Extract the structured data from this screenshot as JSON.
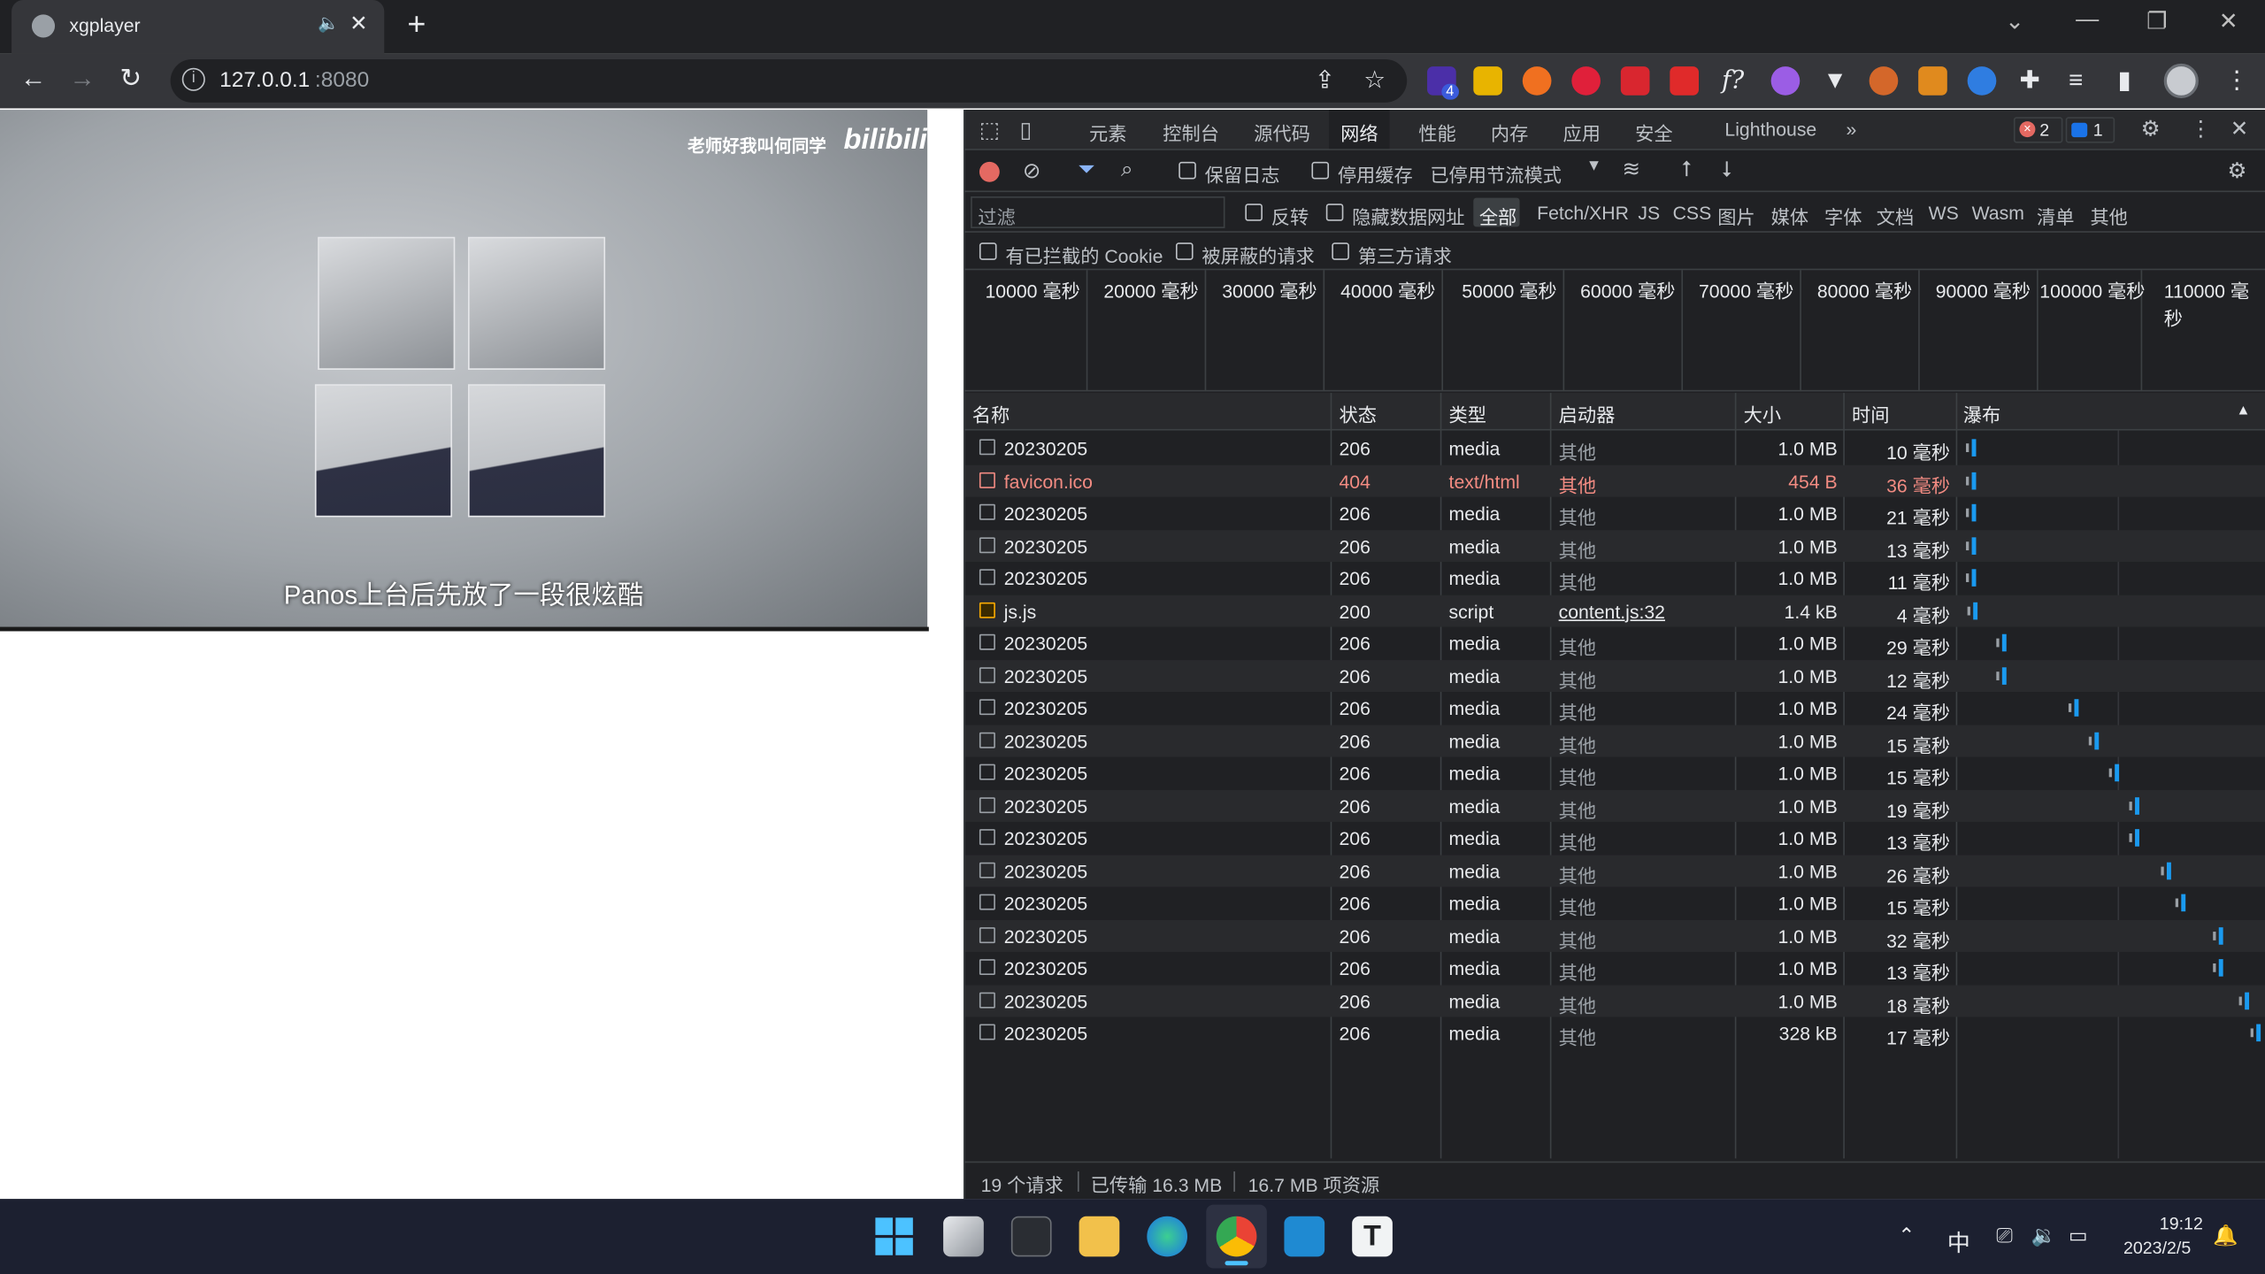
{
  "browser": {
    "tab_title": "xgplayer",
    "tab_close": "✕",
    "new_tab": "+",
    "url_host": "127.0.0.1",
    "url_port": ":8080",
    "ext_badge": "4"
  },
  "video": {
    "watermark": "老师好我叫何同学",
    "logo": "bilibili",
    "subtitle": "Panos上台后先放了一段很炫酷"
  },
  "devtools": {
    "tabs": [
      "元素",
      "控制台",
      "源代码",
      "网络",
      "性能",
      "内存",
      "应用",
      "安全",
      "Lighthouse"
    ],
    "active_tab": "网络",
    "more": "»",
    "errors": "2",
    "messages": "1",
    "controls": {
      "preserve_log": "保留日志",
      "disable_cache": "停用缓存",
      "throttle": "已停用节流模式"
    },
    "filter": {
      "placeholder": "过滤",
      "invert": "反转",
      "hide_data_urls": "隐藏数据网址",
      "types": [
        "全部",
        "Fetch/XHR",
        "JS",
        "CSS",
        "图片",
        "媒体",
        "字体",
        "文档",
        "WS",
        "Wasm",
        "清单",
        "其他"
      ],
      "blocked_cookies": "有已拦截的 Cookie",
      "blocked_requests": "被屏蔽的请求",
      "third_party": "第三方请求"
    },
    "timeline_ticks": [
      "10000 毫秒",
      "20000 毫秒",
      "30000 毫秒",
      "40000 毫秒",
      "50000 毫秒",
      "60000 毫秒",
      "70000 毫秒",
      "80000 毫秒",
      "90000 毫秒",
      "100000 毫秒",
      "110000 毫秒"
    ],
    "columns": {
      "name": "名称",
      "status": "状态",
      "type": "类型",
      "initiator": "启动器",
      "size": "大小",
      "time": "时间",
      "waterfall": "瀑布"
    },
    "rows": [
      {
        "name": "20230205",
        "status": "206",
        "type": "media",
        "initiator": "其他",
        "size": "1.0 MB",
        "time": "10 毫秒",
        "wf": 0.004
      },
      {
        "name": "favicon.ico",
        "status": "404",
        "type": "text/html",
        "initiator": "其他",
        "size": "454 B",
        "time": "36 毫秒",
        "wf": 0.004,
        "error": true
      },
      {
        "name": "20230205",
        "status": "206",
        "type": "media",
        "initiator": "其他",
        "size": "1.0 MB",
        "time": "21 毫秒",
        "wf": 0.004
      },
      {
        "name": "20230205",
        "status": "206",
        "type": "media",
        "initiator": "其他",
        "size": "1.0 MB",
        "time": "13 毫秒",
        "wf": 0.004
      },
      {
        "name": "20230205",
        "status": "206",
        "type": "media",
        "initiator": "其他",
        "size": "1.0 MB",
        "time": "11 毫秒",
        "wf": 0.004
      },
      {
        "name": "js.js",
        "status": "200",
        "type": "script",
        "initiator": "content.js:32",
        "size": "1.4 kB",
        "time": "4 毫秒",
        "wf": 0.01,
        "script": true
      },
      {
        "name": "20230205",
        "status": "206",
        "type": "media",
        "initiator": "其他",
        "size": "1.0 MB",
        "time": "29 毫秒",
        "wf": 0.11
      },
      {
        "name": "20230205",
        "status": "206",
        "type": "media",
        "initiator": "其他",
        "size": "1.0 MB",
        "time": "12 毫秒",
        "wf": 0.11
      },
      {
        "name": "20230205",
        "status": "206",
        "type": "media",
        "initiator": "其他",
        "size": "1.0 MB",
        "time": "24 毫秒",
        "wf": 0.36
      },
      {
        "name": "20230205",
        "status": "206",
        "type": "media",
        "initiator": "其他",
        "size": "1.0 MB",
        "time": "15 毫秒",
        "wf": 0.43
      },
      {
        "name": "20230205",
        "status": "206",
        "type": "media",
        "initiator": "其他",
        "size": "1.0 MB",
        "time": "15 毫秒",
        "wf": 0.5
      },
      {
        "name": "20230205",
        "status": "206",
        "type": "media",
        "initiator": "其他",
        "size": "1.0 MB",
        "time": "19 毫秒",
        "wf": 0.57
      },
      {
        "name": "20230205",
        "status": "206",
        "type": "media",
        "initiator": "其他",
        "size": "1.0 MB",
        "time": "13 毫秒",
        "wf": 0.57
      },
      {
        "name": "20230205",
        "status": "206",
        "type": "media",
        "initiator": "其他",
        "size": "1.0 MB",
        "time": "26 毫秒",
        "wf": 0.68
      },
      {
        "name": "20230205",
        "status": "206",
        "type": "media",
        "initiator": "其他",
        "size": "1.0 MB",
        "time": "15 毫秒",
        "wf": 0.73
      },
      {
        "name": "20230205",
        "status": "206",
        "type": "media",
        "initiator": "其他",
        "size": "1.0 MB",
        "time": "32 毫秒",
        "wf": 0.86
      },
      {
        "name": "20230205",
        "status": "206",
        "type": "media",
        "initiator": "其他",
        "size": "1.0 MB",
        "time": "13 毫秒",
        "wf": 0.86
      },
      {
        "name": "20230205",
        "status": "206",
        "type": "media",
        "initiator": "其他",
        "size": "1.0 MB",
        "time": "18 毫秒",
        "wf": 0.95
      },
      {
        "name": "20230205",
        "status": "206",
        "type": "media",
        "initiator": "其他",
        "size": "328 kB",
        "time": "17 毫秒",
        "wf": 0.99
      }
    ],
    "status_bar": {
      "requests": "19 个请求",
      "transferred": "已传输 16.3 MB",
      "resources": "16.7 MB 项资源"
    }
  },
  "taskbar": {
    "ime": "中",
    "time": "19:12",
    "date": "2023/2/5"
  }
}
